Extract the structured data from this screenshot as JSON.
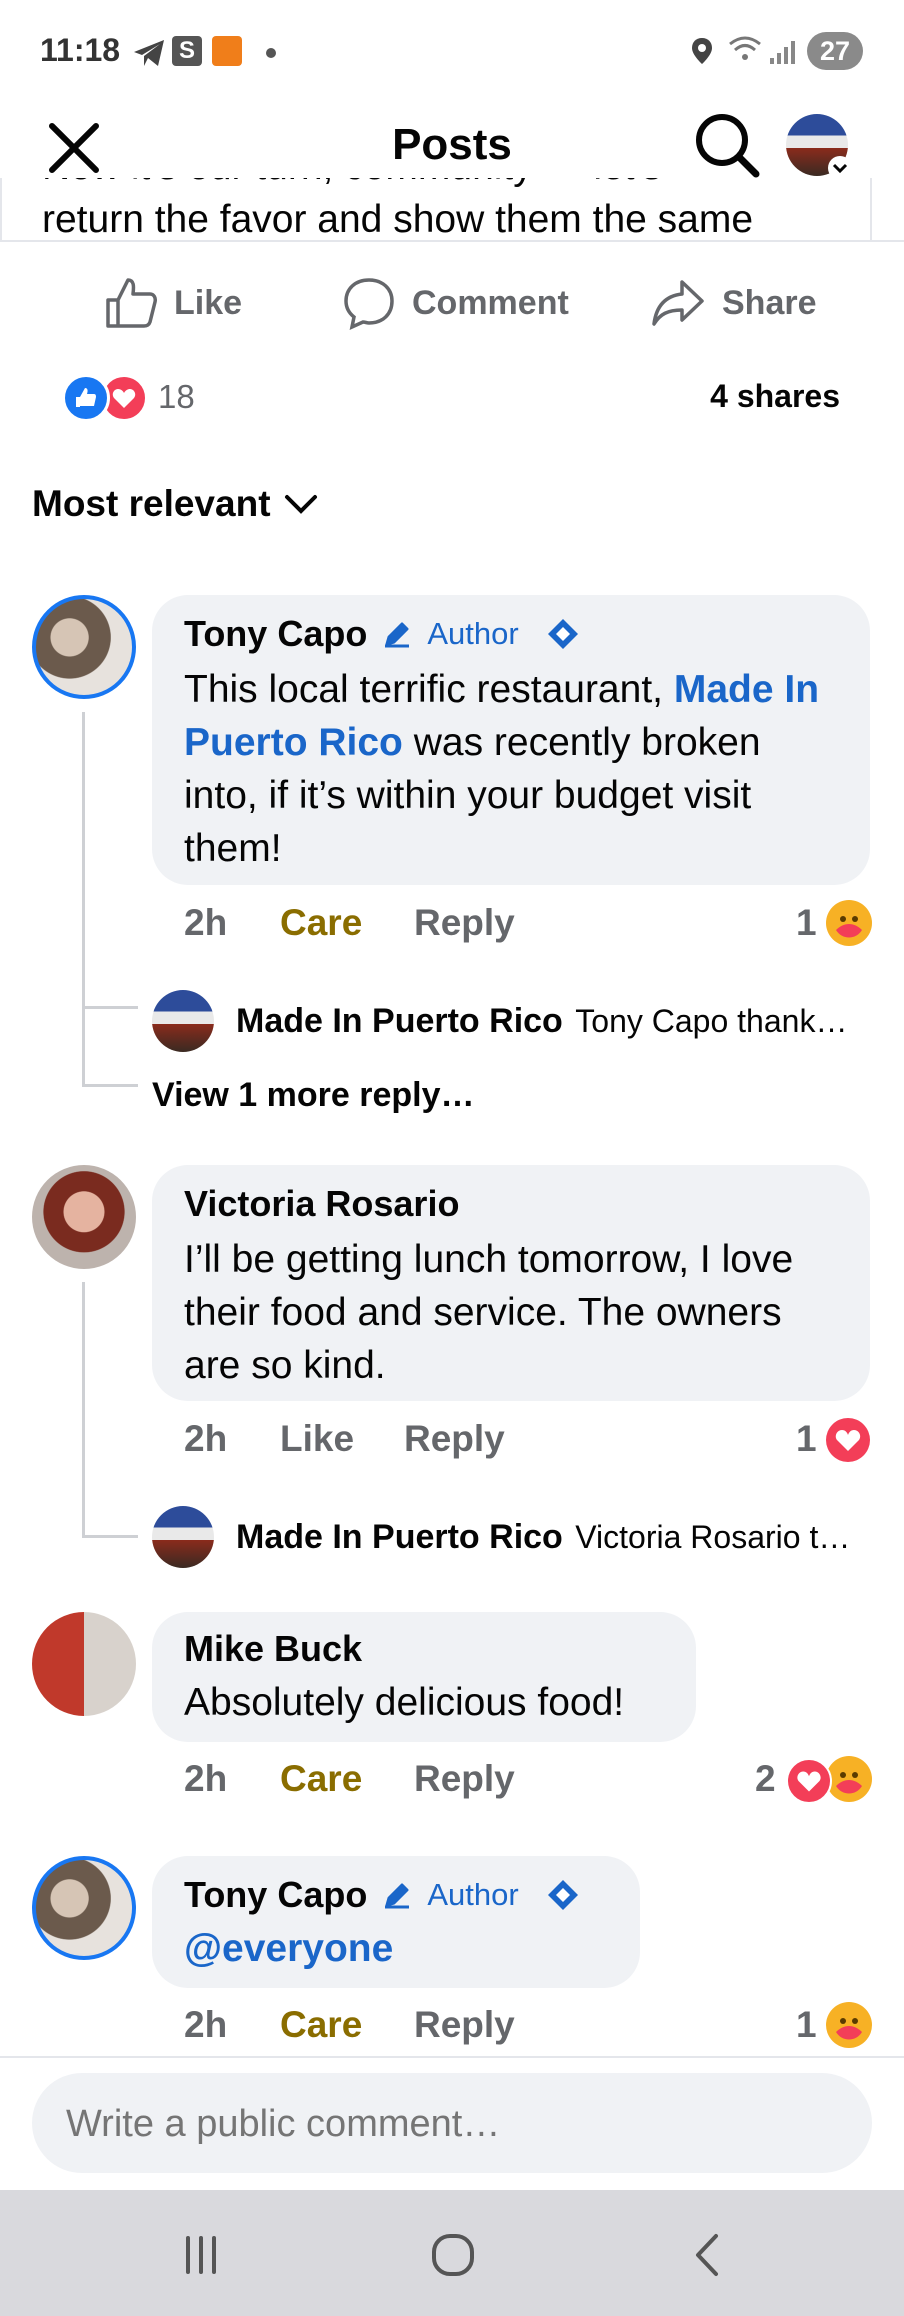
{
  "status_bar": {
    "time": "11:18",
    "battery": "27"
  },
  "header": {
    "title": "Posts",
    "cut_text_1": "Now it's our turn, community — let's",
    "cut_text_2": "return the favor and show them the same"
  },
  "actions": {
    "like": "Like",
    "comment": "Comment",
    "share": "Share"
  },
  "reactions": {
    "count": "18",
    "shares": "4 shares"
  },
  "sort": {
    "label": "Most relevant"
  },
  "comments": [
    {
      "name": "Tony Capo",
      "badge": "Author",
      "text_prefix": "This local terrific restaurant, ",
      "text_link": "Made In Puerto Rico",
      "text_suffix": " was recently broken into, if it’s within your budget visit them!",
      "time": "2h",
      "reaction_label": "Care",
      "reply_label": "Reply",
      "reaction_count": "1",
      "reply_preview_name": "Made In Puerto Rico",
      "reply_preview_text": "Tony Capo thank…",
      "more_replies": "View 1 more reply…"
    },
    {
      "name": "Victoria Rosario",
      "text": "I’ll be getting lunch tomorrow, I love their food and service. The owners are so kind.",
      "time": "2h",
      "reaction_label": "Like",
      "reply_label": "Reply",
      "reaction_count": "1",
      "reply_preview_name": "Made In Puerto Rico",
      "reply_preview_text": "Victoria Rosario t…"
    },
    {
      "name": "Mike Buck",
      "text": "Absolutely delicious food!",
      "time": "2h",
      "reaction_label": "Care",
      "reply_label": "Reply",
      "reaction_count": "2"
    },
    {
      "name": "Tony Capo",
      "badge": "Author",
      "text_link": "@everyone",
      "time": "2h",
      "reaction_label": "Care",
      "reply_label": "Reply",
      "reaction_count": "1"
    }
  ],
  "composer": {
    "placeholder": "Write a public comment…"
  },
  "colors": {
    "accent": "#1a66c9",
    "care": "#8a6d00",
    "bubble": "#f0f2f5"
  }
}
